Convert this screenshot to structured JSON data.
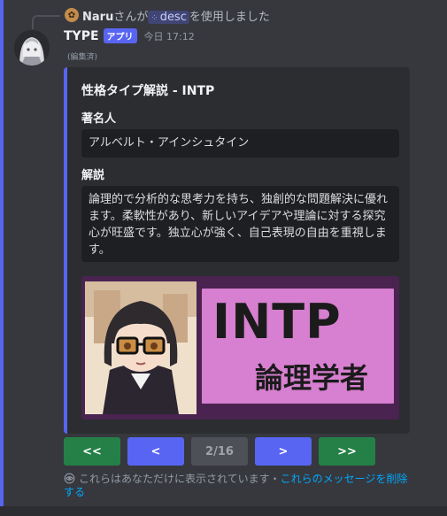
{
  "reply": {
    "user": "Naru",
    "text_pre": "さんが",
    "command": "desc",
    "text_post": "を使用しました",
    "avatar_icon": "flower-icon"
  },
  "message": {
    "author": "TYPE",
    "badge": "アプリ",
    "timestamp": "今日 17:12",
    "edited": "(編集済)"
  },
  "embed": {
    "title": "性格タイプ解説 - INTP",
    "fields": [
      {
        "name": "著名人",
        "value": "アルベルト・アインシュタイン"
      },
      {
        "name": "解説",
        "value": "論理的で分析的な思考力を持ち、独創的な問題解決に優れます。柔軟性があり、新しいアイデアや理論に対する探究心が旺盛です。独立心が強く、自己表現の自由を重視します。"
      }
    ],
    "accent_color": "#5865f2",
    "image": {
      "big_text": "INTP",
      "small_text": "論理学者",
      "panel_color": "#d77fd0",
      "background_color": "#4a2350"
    }
  },
  "buttons": {
    "first": "<<",
    "prev": "<",
    "page": "2/16",
    "next": ">",
    "last": ">>"
  },
  "ephemeral": {
    "notice": "これらはあなただけに表示されています・",
    "link": "これらのメッセージを削除する",
    "icon": "eye-icon"
  }
}
